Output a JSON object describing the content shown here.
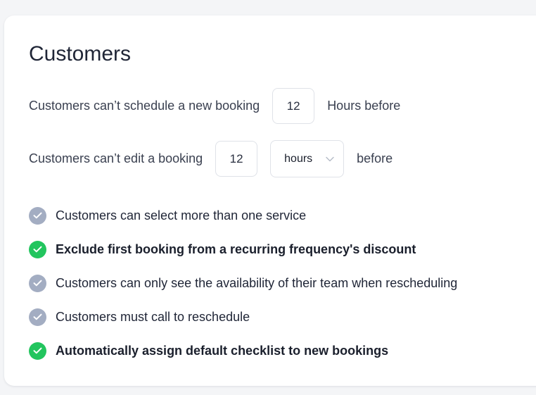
{
  "section": {
    "title": "Customers"
  },
  "schedule_rule": {
    "prefix": "Customers can’t schedule a new booking",
    "value": "12",
    "suffix": "Hours before"
  },
  "edit_rule": {
    "prefix": "Customers can’t edit a booking",
    "value": "12",
    "unit_selected": "hours",
    "suffix": "before"
  },
  "options": [
    {
      "label": "Customers can select more than one service",
      "checked": false
    },
    {
      "label": "Exclude first booking from a recurring frequency's discount",
      "checked": true
    },
    {
      "label": "Customers can only see the availability of their team when rescheduling",
      "checked": false
    },
    {
      "label": "Customers must call to reschedule",
      "checked": false
    },
    {
      "label": "Automatically assign default checklist to new bookings",
      "checked": true
    }
  ],
  "colors": {
    "checked": "#22c55e",
    "unchecked": "#a3adc2",
    "checkmark": "#ffffff"
  },
  "icons": {
    "checked": "check-circle-icon",
    "unchecked": "check-circle-icon",
    "select": "chevron-down-icon"
  }
}
